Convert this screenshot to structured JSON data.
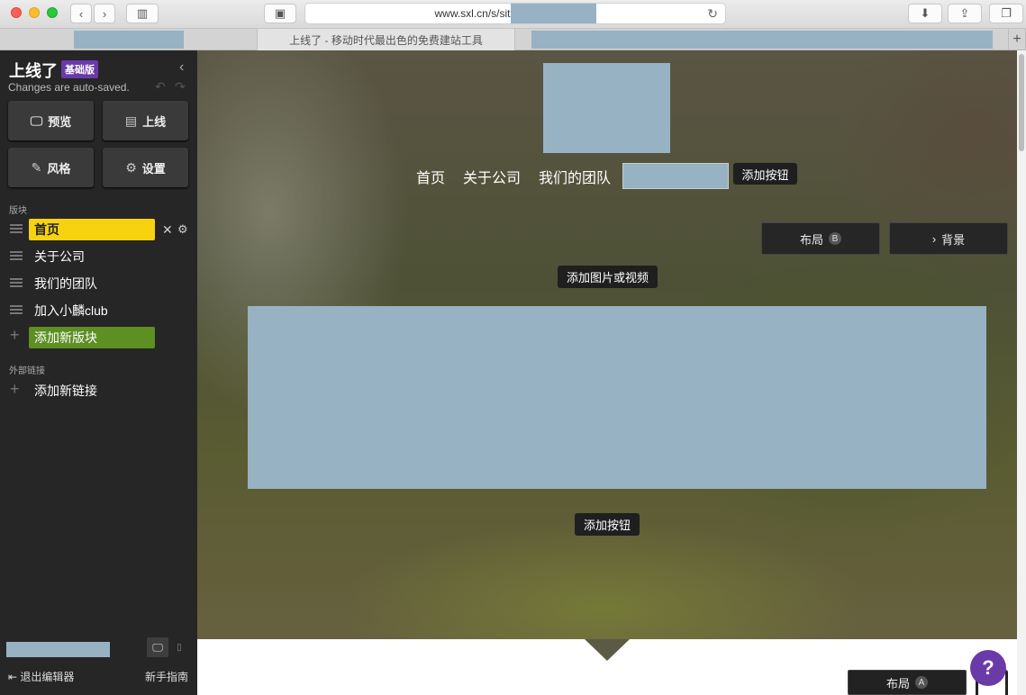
{
  "browser": {
    "url": "www.sxl.cn/s/sit",
    "tabs": [
      {
        "label": ""
      },
      {
        "label": "上线了 - 移动时代最出色的免费建站工具"
      },
      {
        "label": ""
      }
    ]
  },
  "sidebar": {
    "logo": "上线了",
    "badge": "基础版",
    "autosave": "Changes are auto-saved.",
    "buttons": {
      "preview": "预览",
      "publish": "上线",
      "style": "风格",
      "settings": "设置"
    },
    "sections_label": "版块",
    "sections": [
      {
        "label": "首页"
      },
      {
        "label": "关于公司"
      },
      {
        "label": "我们的团队"
      },
      {
        "label": "加入小麟club"
      }
    ],
    "add_section": "添加新版块",
    "links_label": "外部链接",
    "add_link": "添加新链接",
    "exit": "退出编辑器",
    "guide": "新手指南"
  },
  "canvas": {
    "nav": [
      "首页",
      "关于公司",
      "我们的团队"
    ],
    "add_button": "添加按钮",
    "layout_btn": "布局",
    "layout_key": "B",
    "background_btn": "背景",
    "add_media": "添加图片或视频",
    "add_button_bottom": "添加按钮"
  },
  "next_section": {
    "layout_btn": "布局",
    "layout_key": "A"
  },
  "help": "?",
  "colors": {
    "accent_yellow": "#f7d20f",
    "accent_green": "#5d8f22",
    "brand_purple": "#6a3aa8",
    "sidebar_bg": "#262626"
  }
}
